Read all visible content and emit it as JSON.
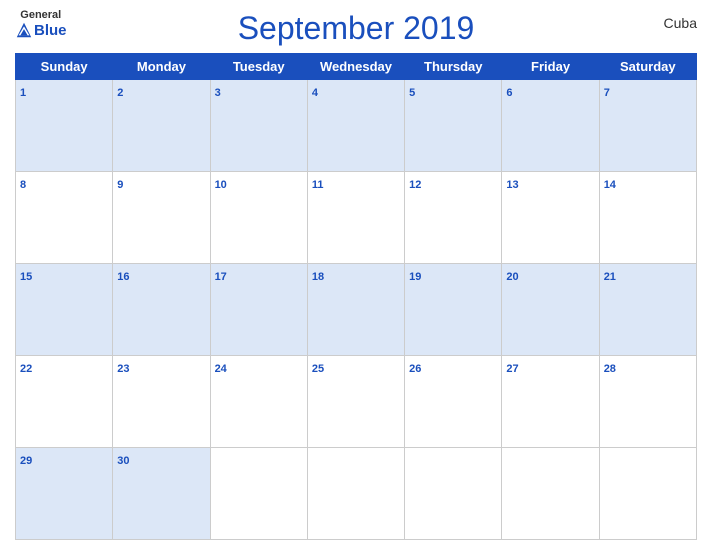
{
  "header": {
    "logo_general": "General",
    "logo_blue": "Blue",
    "title": "September 2019",
    "country": "Cuba"
  },
  "weekdays": [
    "Sunday",
    "Monday",
    "Tuesday",
    "Wednesday",
    "Thursday",
    "Friday",
    "Saturday"
  ],
  "weeks": [
    [
      1,
      2,
      3,
      4,
      5,
      6,
      7
    ],
    [
      8,
      9,
      10,
      11,
      12,
      13,
      14
    ],
    [
      15,
      16,
      17,
      18,
      19,
      20,
      21
    ],
    [
      22,
      23,
      24,
      25,
      26,
      27,
      28
    ],
    [
      29,
      30,
      null,
      null,
      null,
      null,
      null
    ]
  ]
}
